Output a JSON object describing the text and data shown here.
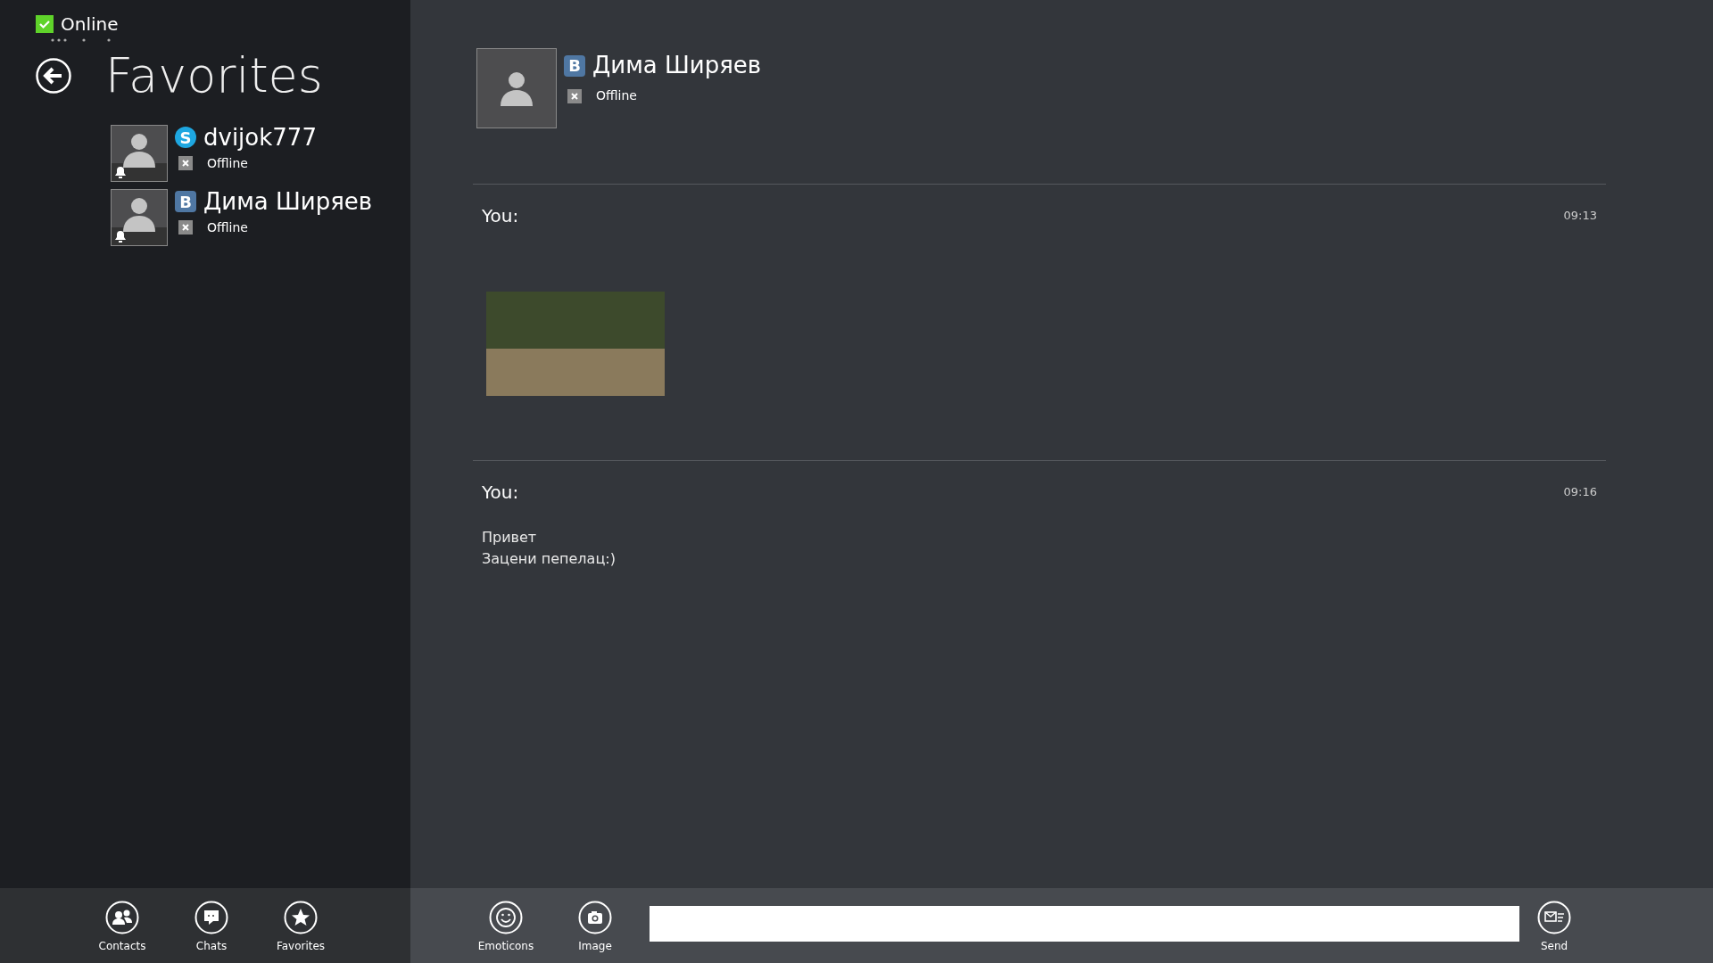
{
  "presence": {
    "label": "Online",
    "online": true
  },
  "title": "Favorites",
  "contacts": [
    {
      "service": {
        "kind": "skype",
        "letter": "S"
      },
      "name": "dvijok777",
      "status": "Offline",
      "online": false
    },
    {
      "service": {
        "kind": "vk",
        "letter": "B"
      },
      "name": "Дима Ширяев",
      "status": "Offline",
      "online": false
    }
  ],
  "chat_header": {
    "service": {
      "kind": "vk",
      "letter": "B"
    },
    "name": "Дима Ширяев",
    "status": "Offline",
    "online": false
  },
  "messages": [
    {
      "kind": "image",
      "sender": "You:",
      "time": "09:13"
    },
    {
      "kind": "text",
      "sender": "You:",
      "time": "09:16",
      "lines": [
        "Привет",
        "Зацени пепелац:)"
      ]
    }
  ],
  "left_bar": [
    {
      "kind": "contacts",
      "label": "Contacts"
    },
    {
      "kind": "chats",
      "label": "Chats"
    },
    {
      "kind": "favorites",
      "label": "Favorites"
    }
  ],
  "right_bar": [
    {
      "kind": "emoticons",
      "label": "Emoticons"
    },
    {
      "kind": "image",
      "label": "Image"
    }
  ],
  "send": {
    "kind": "send",
    "label": "Send"
  }
}
